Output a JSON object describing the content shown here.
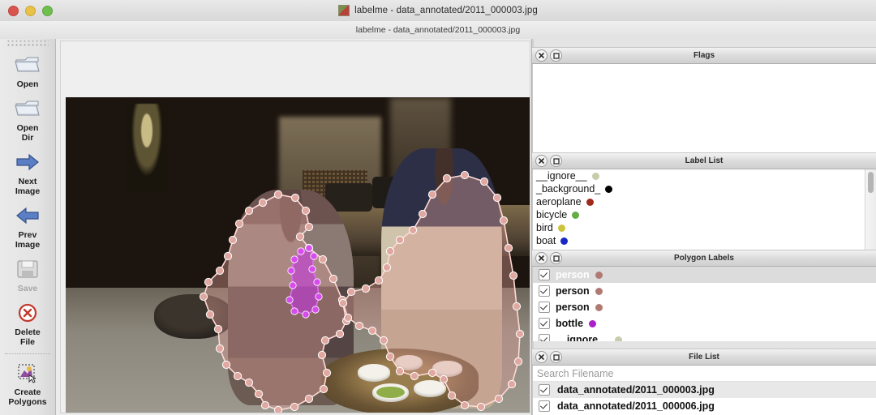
{
  "window": {
    "title": "labelme - data_annotated/2011_000003.jpg",
    "subtitle": "labelme - data_annotated/2011_000003.jpg",
    "app_icon": "labelme-app-icon",
    "traffic_lights": [
      "close-button",
      "minimize-button",
      "zoom-button"
    ]
  },
  "toolbar": {
    "items": [
      {
        "label": "Open",
        "icon": "open-folder-icon",
        "enabled": true
      },
      {
        "label": "Open\nDir",
        "icon": "open-dir-folder-icon",
        "enabled": true
      },
      {
        "label": "Next\nImage",
        "icon": "arrow-right-icon",
        "enabled": true
      },
      {
        "label": "Prev\nImage",
        "icon": "arrow-left-icon",
        "enabled": true
      },
      {
        "label": "Save",
        "icon": "floppy-disk-icon",
        "enabled": false
      },
      {
        "label": "Delete\nFile",
        "icon": "delete-circle-icon",
        "enabled": true
      },
      {
        "label": "Create\nPolygons",
        "icon": "create-polygon-icon",
        "enabled": true
      }
    ]
  },
  "panels": {
    "flags": {
      "title": "Flags",
      "items": []
    },
    "label_list": {
      "title": "Label List",
      "items": [
        {
          "label": "__ignore__",
          "color": "#c8ccab"
        },
        {
          "label": "_background_",
          "color": "#000000"
        },
        {
          "label": "aeroplane",
          "color": "#9c2b1b"
        },
        {
          "label": "bicycle",
          "color": "#63ad45"
        },
        {
          "label": "bird",
          "color": "#cdc23f"
        },
        {
          "label": "boat",
          "color": "#1b27c4"
        }
      ]
    },
    "polygon_labels": {
      "title": "Polygon Labels",
      "items": [
        {
          "label": "person",
          "color": "#b07a72",
          "checked": true,
          "selected": true
        },
        {
          "label": "person",
          "color": "#b07a72",
          "checked": true,
          "selected": false
        },
        {
          "label": "person",
          "color": "#b07a72",
          "checked": true,
          "selected": false
        },
        {
          "label": "bottle",
          "color": "#ab20c9",
          "checked": true,
          "selected": false
        },
        {
          "label": "__ignore__",
          "color": "#c8ccab",
          "checked": true,
          "selected": false
        }
      ]
    },
    "file_list": {
      "title": "File List",
      "search_placeholder": "Search Filename",
      "search_value": "",
      "items": [
        {
          "label": "data_annotated/2011_000003.jpg",
          "checked": true,
          "selected": true
        },
        {
          "label": "data_annotated/2011_000006.jpg",
          "checked": true,
          "selected": false
        }
      ]
    },
    "header_buttons": [
      "close-panel-icon",
      "float-panel-icon"
    ]
  },
  "canvas": {
    "image_name": "2011_000003.jpg",
    "shapes": [
      {
        "name": "person",
        "color": "#d89a93"
      },
      {
        "name": "person",
        "color": "#d89a93"
      },
      {
        "name": "bottle",
        "color": "#c531e8"
      }
    ]
  },
  "colors": {
    "polygon_person": "#d89a93",
    "polygon_bottle": "#c531e8",
    "selection_bg": "#dcdcdc",
    "panel_header": "#dcdcdc"
  }
}
